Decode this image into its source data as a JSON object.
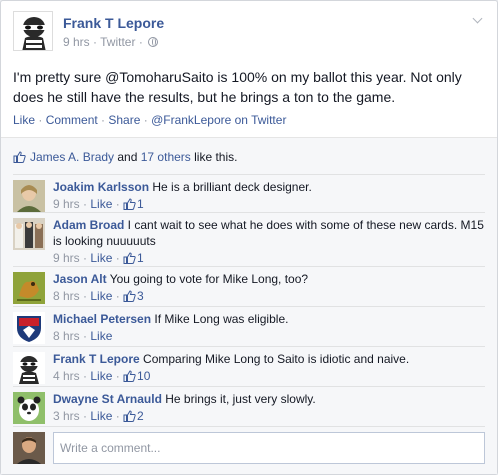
{
  "post": {
    "author": "Frank T Lepore",
    "time": "9 hrs",
    "source": "Twitter",
    "dot": " · ",
    "text": "I'm pretty sure @TomoharuSaito is 100% on my ballot this year. Not only does he still have the results, but he brings a ton to the game.",
    "actions": {
      "like": "Like",
      "comment": "Comment",
      "share": "Share",
      "twitter": "@FrankLepore on Twitter"
    }
  },
  "likes": {
    "name": "James A. Brady",
    "and": " and ",
    "others": "17 others",
    "suffix": " like this."
  },
  "comments": [
    {
      "name": "Joakim Karlsson",
      "text": " He is a brilliant deck designer.",
      "time": "9 hrs",
      "like": "Like",
      "count": "1"
    },
    {
      "name": "Adam Broad",
      "text": " I cant wait to see what he does with some of these new cards. M15 is looking nuuuuuts",
      "time": "9 hrs",
      "like": "Like",
      "count": "1"
    },
    {
      "name": "Jason Alt",
      "text": " You going to vote for Mike Long, too?",
      "time": "8 hrs",
      "like": "Like",
      "count": "3"
    },
    {
      "name": "Michael Petersen",
      "text": " If Mike Long was eligible.",
      "time": "8 hrs",
      "like": "Like",
      "count": ""
    },
    {
      "name": "Frank T Lepore",
      "text": " Comparing Mike Long to Saito is idiotic and naive.",
      "time": "4 hrs",
      "like": "Like",
      "count": "10"
    },
    {
      "name": "Dwayne St Arnauld",
      "text": " He brings it, just very slowly.",
      "time": "3 hrs",
      "like": "Like",
      "count": "2"
    }
  ],
  "composer": {
    "placeholder": "Write a comment..."
  },
  "colors": {
    "link": "#3b5998",
    "meta": "#9197a3",
    "feedback_bg": "#f6f7f9"
  }
}
